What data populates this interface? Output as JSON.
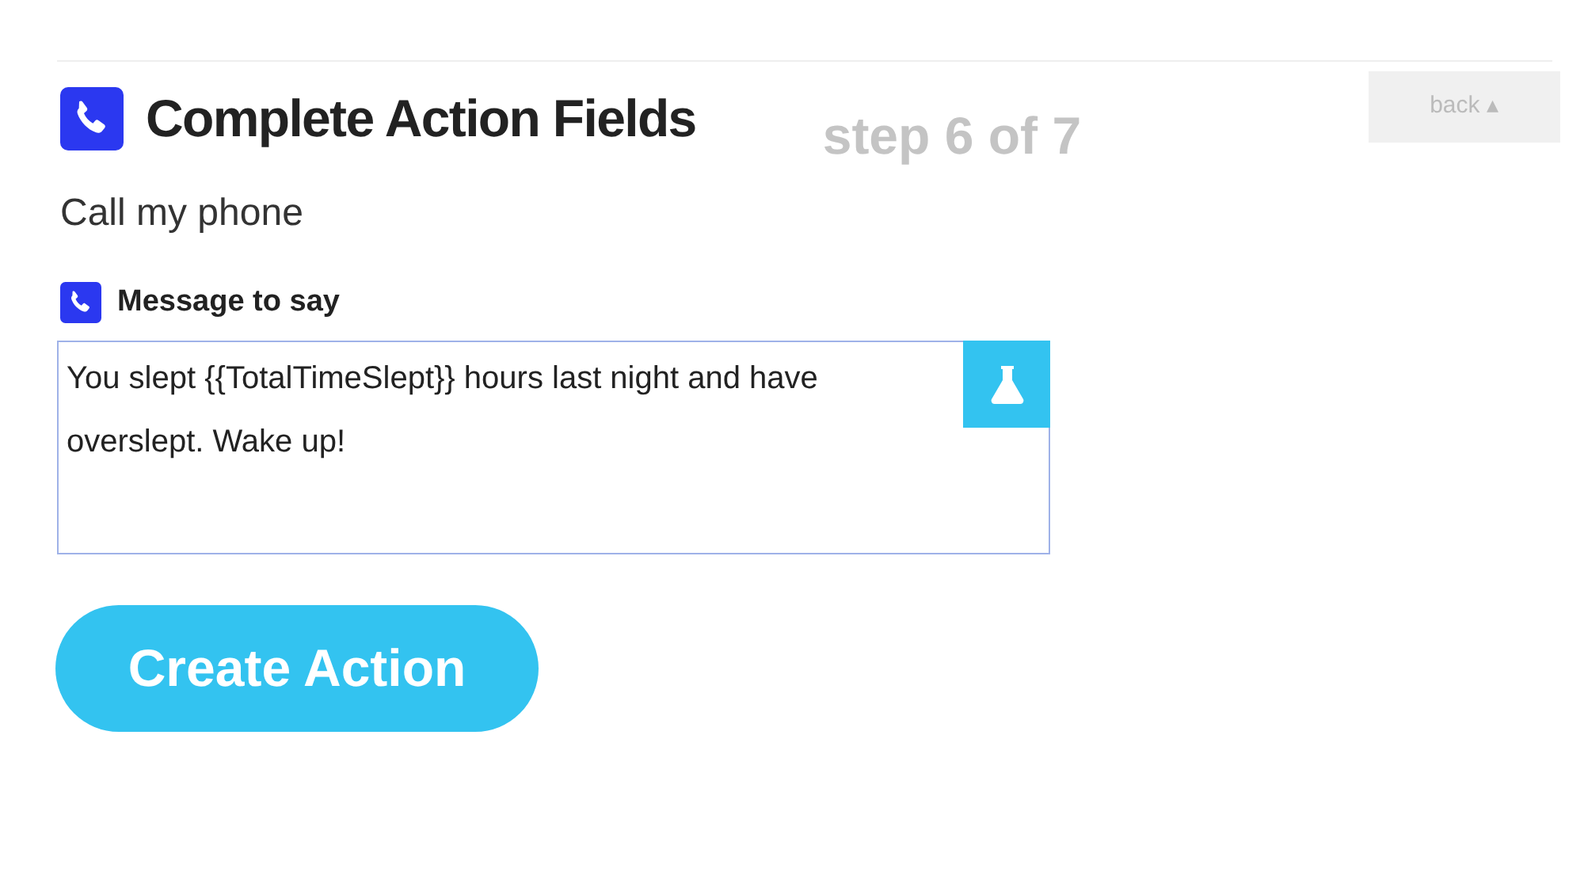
{
  "header": {
    "title": "Complete Action Fields",
    "step": "step 6 of 7",
    "back_button": "back ▴"
  },
  "subtitle": "Call my phone",
  "field": {
    "label": "Message to say",
    "value": "You slept {{TotalTimeSlept}} hours last night and have overslept. Wake up!"
  },
  "submit_button": "Create Action"
}
